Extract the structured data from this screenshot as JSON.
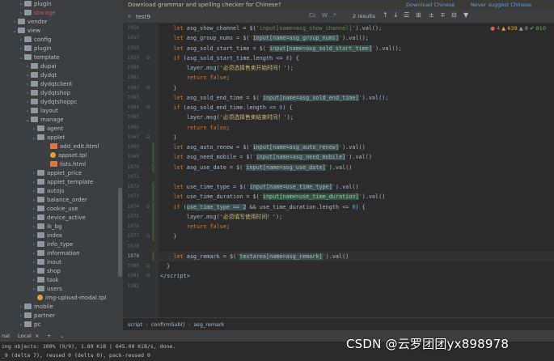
{
  "project_tree": {
    "items": [
      {
        "label": "plugin",
        "kind": "folder",
        "arrow": "›",
        "state": "normal"
      },
      {
        "label": "storage",
        "kind": "folder",
        "arrow": "›",
        "state": "git-red"
      },
      {
        "label": "vendor",
        "kind": "folder",
        "arrow": "›",
        "state": "normal"
      },
      {
        "label": "view",
        "kind": "folder",
        "arrow": "⌄",
        "state": "normal"
      },
      {
        "label": "config",
        "kind": "folder",
        "arrow": "›",
        "state": "normal"
      },
      {
        "label": "plugin",
        "kind": "folder",
        "arrow": "›",
        "state": "normal"
      },
      {
        "label": "template",
        "kind": "folder",
        "arrow": "⌄",
        "state": "normal"
      },
      {
        "label": "dupai",
        "kind": "folder",
        "arrow": "›",
        "state": "normal"
      },
      {
        "label": "dydqt",
        "kind": "folder",
        "arrow": "›",
        "state": "normal"
      },
      {
        "label": "dydqtclient",
        "kind": "folder",
        "arrow": "›",
        "state": "normal"
      },
      {
        "label": "dydqtshop",
        "kind": "folder",
        "arrow": "›",
        "state": "normal"
      },
      {
        "label": "dydqtshoppc",
        "kind": "folder",
        "arrow": "›",
        "state": "normal"
      },
      {
        "label": "layout",
        "kind": "folder",
        "arrow": "›",
        "state": "normal"
      },
      {
        "label": "manage",
        "kind": "folder",
        "arrow": "⌄",
        "state": "normal"
      },
      {
        "label": "agent",
        "kind": "folder",
        "arrow": "›",
        "state": "normal"
      },
      {
        "label": "applet",
        "kind": "folder",
        "arrow": "⌄",
        "state": "normal"
      },
      {
        "label": "add_edit.html",
        "kind": "html",
        "arrow": "",
        "state": "normal"
      },
      {
        "label": "appset.tpl",
        "kind": "tpl",
        "arrow": "",
        "state": "normal"
      },
      {
        "label": "lists.html",
        "kind": "html",
        "arrow": "",
        "state": "normal"
      },
      {
        "label": "applet_price",
        "kind": "folder",
        "arrow": "›",
        "state": "normal"
      },
      {
        "label": "applet_template",
        "kind": "folder",
        "arrow": "›",
        "state": "normal"
      },
      {
        "label": "autojs",
        "kind": "folder",
        "arrow": "›",
        "state": "normal"
      },
      {
        "label": "balance_order",
        "kind": "folder",
        "arrow": "›",
        "state": "normal"
      },
      {
        "label": "cookie_use",
        "kind": "folder",
        "arrow": "›",
        "state": "normal"
      },
      {
        "label": "device_active",
        "kind": "folder",
        "arrow": "›",
        "state": "normal"
      },
      {
        "label": "ik_bg",
        "kind": "folder",
        "arrow": "›",
        "state": "normal"
      },
      {
        "label": "index",
        "kind": "folder",
        "arrow": "›",
        "state": "normal"
      },
      {
        "label": "info_type",
        "kind": "folder",
        "arrow": "›",
        "state": "normal"
      },
      {
        "label": "information",
        "kind": "folder",
        "arrow": "›",
        "state": "normal"
      },
      {
        "label": "inout",
        "kind": "folder",
        "arrow": "›",
        "state": "normal"
      },
      {
        "label": "shop",
        "kind": "folder",
        "arrow": "›",
        "state": "normal"
      },
      {
        "label": "task",
        "kind": "folder",
        "arrow": "›",
        "state": "normal"
      },
      {
        "label": "users",
        "kind": "folder",
        "arrow": "›",
        "state": "normal"
      },
      {
        "label": "img-upload-modal.tpl",
        "kind": "tpl",
        "arrow": "",
        "state": "normal"
      },
      {
        "label": "mobile",
        "kind": "folder",
        "arrow": "›",
        "state": "normal"
      },
      {
        "label": "partner",
        "kind": "folder",
        "arrow": "›",
        "state": "normal"
      },
      {
        "label": "pc",
        "kind": "folder",
        "arrow": "›",
        "state": "normal"
      }
    ]
  },
  "notification": {
    "text": "Download grammar and spelling checker for Chinese?",
    "download_link": "Download Chinese",
    "never_link": "Never suggest Chinese"
  },
  "search": {
    "value": "test9",
    "options": {
      "cc": "Cc",
      "w": "W",
      "regex": ".*"
    },
    "result_count": "2 results",
    "icons": {
      "prev": "up-arrow-icon",
      "next": "down-arrow-icon"
    }
  },
  "inspections": {
    "errors": "4",
    "warnings": "639",
    "weak_warnings": "8",
    "ok": "810"
  },
  "editor": {
    "current_line": "1979",
    "lines": [
      {
        "n": "1956",
        "html": "    <span class=\"kw\">let</span> asg_show_channel = $(<span class=\"str\">'input[name=asg_show_channel]'</span>).val();"
      },
      {
        "n": "1957",
        "html": "    <span class=\"kw\">let</span> asg_group_nums = $(<span class=\"str\">'</span><span class=\"hl-match\">input[name=asg_group_nums]</span><span class=\"str\">'</span>).val();"
      },
      {
        "n": "1958",
        "html": "    <span class=\"kw\">let</span> asg_sold_start_time = $(<span class=\"str\">'</span><span class=\"hl-match\">input[name=asg_sold_start_time]</span><span class=\"str\">'</span>).val();"
      },
      {
        "n": "1959",
        "html": "    <span class=\"kw\">if</span> (asg_sold_start_time.length &lt;= <span class=\"num\">0</span>) {"
      },
      {
        "n": "1960",
        "html": "        layer.msg(<span class=\"ch\">'必须选择售卖开始时间！'</span>);"
      },
      {
        "n": "1961",
        "html": "        <span class=\"kw\">return false</span>;"
      },
      {
        "n": "1962",
        "html": "    }"
      },
      {
        "n": "1963",
        "html": "    <span class=\"kw\">let</span> asg_sold_end_time = $(<span class=\"str\">'</span><span class=\"hl-match\">input[name=asg_sold_end_time]</span><span class=\"str\">'</span>).val();"
      },
      {
        "n": "1964",
        "html": "    <span class=\"kw\">if</span> (asg_sold_end_time.length &lt;= <span class=\"num\">0</span>) {"
      },
      {
        "n": "1965",
        "html": "        layer.msg(<span class=\"ch\">'必须选择售卖结束时间！'</span>);"
      },
      {
        "n": "1966",
        "html": "        <span class=\"kw\">return false</span>;"
      },
      {
        "n": "1967",
        "html": "    }"
      },
      {
        "n": "1968",
        "html": "    <span class=\"kw\">let</span> asg_auto_renew = $(<span class=\"str\">'</span><span class=\"hl-match\">input[name=asg_auto_renew]</span><span class=\"str\">'</span>).val()"
      },
      {
        "n": "1969",
        "html": "    <span class=\"kw\">let</span> asg_need_mobile = $(<span class=\"str\">'</span><span class=\"hl-match\">input[name=asg_need_mobile]</span><span class=\"str\">'</span>).val()"
      },
      {
        "n": "1970",
        "html": "    <span class=\"kw\">let</span> asg_use_date = $(<span class=\"str\">'</span><span class=\"hl-match\">input[name=asg_use_date]</span><span class=\"str\">'</span>).val()"
      },
      {
        "n": "1971",
        "html": ""
      },
      {
        "n": "1972",
        "html": "    <span class=\"kw\">let</span> use_time_type = $(<span class=\"str\">'</span><span class=\"hl-match\">input[name=use_time_type]</span><span class=\"str\">'</span>).val()"
      },
      {
        "n": "1973",
        "html": "    <span class=\"kw\">let</span> use_time_duration = $(<span class=\"str\">'</span><span class=\"hl-sel\">input[name=use_time_duration]</span><span class=\"str\">'</span>).val()"
      },
      {
        "n": "1974",
        "html": "    <span class=\"kw\">if</span> (<span class=\"hl-match\">use_time_type == 2</span> &amp;&amp; use_time_duration.length &lt;= <span class=\"num\">0</span>) {"
      },
      {
        "n": "1975",
        "html": "        layer.msg(<span class=\"ch\">'必须填写使用时间！'</span>);"
      },
      {
        "n": "1976",
        "html": "        <span class=\"kw\">return false</span>;"
      },
      {
        "n": "1977",
        "html": "    }"
      },
      {
        "n": "1978",
        "html": ""
      },
      {
        "n": "1979",
        "html": "    <span class=\"kw\">let</span> asg_remark = $(<span class=\"str\">'</span><span class=\"hl-match\">textarea[name=asg_remark]</span><span class=\"str\">'</span>).val()"
      },
      {
        "n": "1980",
        "html": "  }"
      },
      {
        "n": "1981",
        "html": "&lt;/script&gt;"
      },
      {
        "n": "1982",
        "html": ""
      }
    ]
  },
  "breadcrumbs": [
    "script",
    "confirmSub()",
    "asg_remark"
  ],
  "terminal": {
    "tabs": [
      "nal",
      "Local"
    ],
    "add": "+",
    "menu": "⌄",
    "lines": [
      "ing objects: 100% (9/9), 1.89 KiB | 645.00 KiB/s, done.",
      "_9 (delta 7), reused 0 (delta 0), pack-reused 0"
    ]
  },
  "watermark": "CSDN @云罗团团yx898978",
  "colors": {
    "accent": "#4b6eaf",
    "keyword": "#cc7832",
    "string": "#6a8759",
    "background": "#2b2b2b"
  }
}
